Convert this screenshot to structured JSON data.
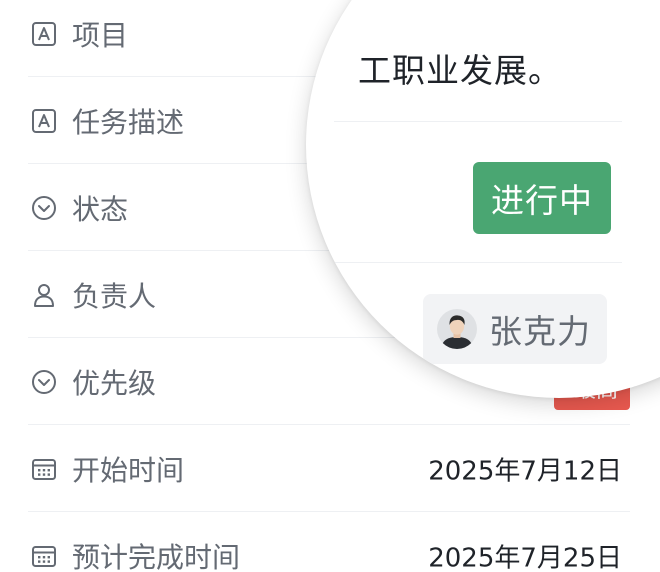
{
  "fields": [
    {
      "label": "项目",
      "icon": "text-field-icon"
    },
    {
      "label": "任务描述",
      "icon": "text-field-icon"
    },
    {
      "label": "状态",
      "icon": "single-select-icon"
    },
    {
      "label": "负责人",
      "icon": "person-icon"
    },
    {
      "label": "优先级",
      "icon": "single-select-icon"
    },
    {
      "label": "开始时间",
      "icon": "calendar-icon",
      "value": "2025年7月12日"
    },
    {
      "label": "预计完成时间",
      "icon": "calendar-icon",
      "value": "2025年7月25日"
    }
  ],
  "magnifier": {
    "description_fragment": "工职业发展。",
    "status": {
      "label": "进行中",
      "color": "#4aa672"
    },
    "owner": {
      "name": "张克力",
      "avatar_icon": "user-avatar"
    },
    "priority_fragment": "最高",
    "priority_color": "#e8594f",
    "project_tag_color": "#a9c6f2"
  }
}
